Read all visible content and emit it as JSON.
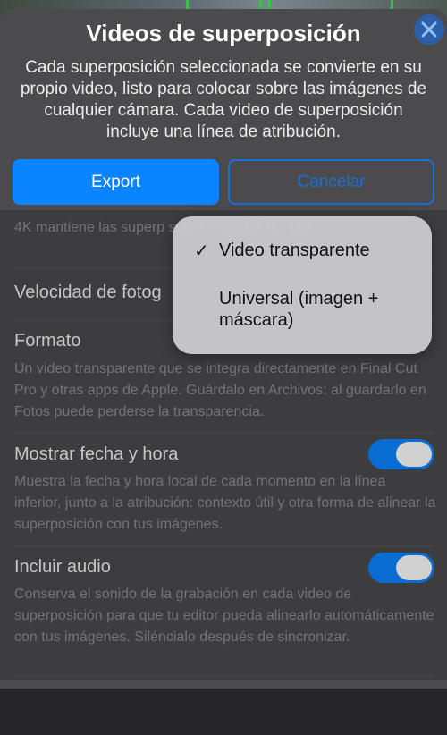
{
  "sheet": {
    "title": "Videos de superposición",
    "subtitle": "Cada superposición seleccionada se convierte en su propio video, listo para colocar sobre las imágenes de cualquier cámara. Cada video de superposición incluye una línea de atribución."
  },
  "buttons": {
    "export_label": "Export",
    "cancel_label": "Cancelar"
  },
  "settings": {
    "resolution_note": "4K mantiene las superp sobre material 4K; 108",
    "speed_label": "Velocidad de fotog",
    "format_label": "Formato",
    "format_desc": "Un video transparente que se integra directamente en Final Cut Pro y otras apps de Apple. Guárdalo en Archivos: al guardarlo en Fotos puede perderse la transparencia.",
    "datetime_label": "Mostrar fecha y hora",
    "datetime_desc": "Muestra la fecha y hora local de cada momento en la línea inferior, junto a la atribución: contexto útil y otra forma de alinear la superposición con tus imágenes.",
    "datetime_on": true,
    "audio_label": "Incluir audio",
    "audio_desc": "Conserva el sonido de la grabación en cada video de superposición para que tu editor pueda alinearlo automáticamente con tus imágenes. Siléncialo después de sincronizar.",
    "audio_on": true
  },
  "format_menu": {
    "items": [
      {
        "check": "✓",
        "label": "Video transparente",
        "selected": true
      },
      {
        "check": "",
        "label": "Universal (imagen + máscara)",
        "selected": false
      }
    ]
  },
  "colors": {
    "accent": "#0a84ff",
    "sheet_bg": "#4b4b4d",
    "menu_bg": "#cdcdd0"
  },
  "icons": {
    "close": "close-icon",
    "check": "checkmark-icon"
  }
}
